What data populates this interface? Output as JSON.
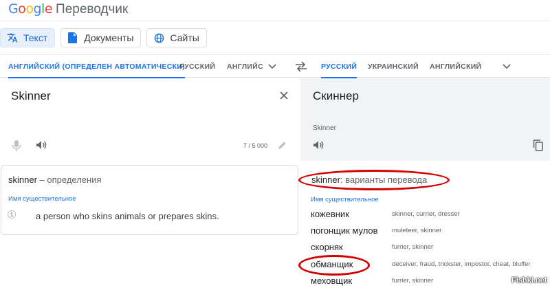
{
  "header": {
    "logo": "Google",
    "product": "Переводчик"
  },
  "modes": [
    {
      "label": "Текст",
      "icon": "translate-icon",
      "active": true
    },
    {
      "label": "Документы",
      "icon": "document-icon",
      "active": false
    },
    {
      "label": "Сайты",
      "icon": "globe-icon",
      "active": false
    }
  ],
  "source_langs": [
    {
      "label": "АНГЛИЙСКИЙ (ОПРЕДЕЛЕН АВТОМАТИЧЕСКИ)",
      "active": true
    },
    {
      "label": "РУССКИЙ",
      "active": false
    },
    {
      "label": "АНГЛИЙС",
      "active": false
    }
  ],
  "target_langs": [
    {
      "label": "РУССКИЙ",
      "active": true
    },
    {
      "label": "УКРАИНСКИЙ",
      "active": false
    },
    {
      "label": "АНГЛИЙСКИЙ",
      "active": false
    }
  ],
  "source": {
    "text": "Skinner",
    "char_count": "7 / 5 000"
  },
  "target": {
    "text": "Скиннер",
    "romanization": "Skinner"
  },
  "definitions": {
    "word": "skinner",
    "suffix": " – определения",
    "pos": "Имя существительное",
    "items": [
      {
        "num": "1",
        "text": "a person who skins animals or prepares skins."
      }
    ]
  },
  "translations": {
    "word": "skinner",
    "suffix": ": варианты перевода",
    "pos": "Имя существительное",
    "rows": [
      {
        "word": "кожевник",
        "synonyms": "skinner, currier, dresser"
      },
      {
        "word": "погонщик мулов",
        "synonyms": "muleteer, skinner"
      },
      {
        "word": "скорняк",
        "synonyms": "furrier, skinner"
      },
      {
        "word": "обманщик",
        "synonyms": "deceiver, fraud, trickster, impostor, cheat, bluffer"
      },
      {
        "word": "меховщик",
        "synonyms": "furrier, skinner"
      }
    ]
  },
  "colors": {
    "accent": "#1a73e8",
    "annotation": "#d40000"
  },
  "watermark": "Fishki.net"
}
